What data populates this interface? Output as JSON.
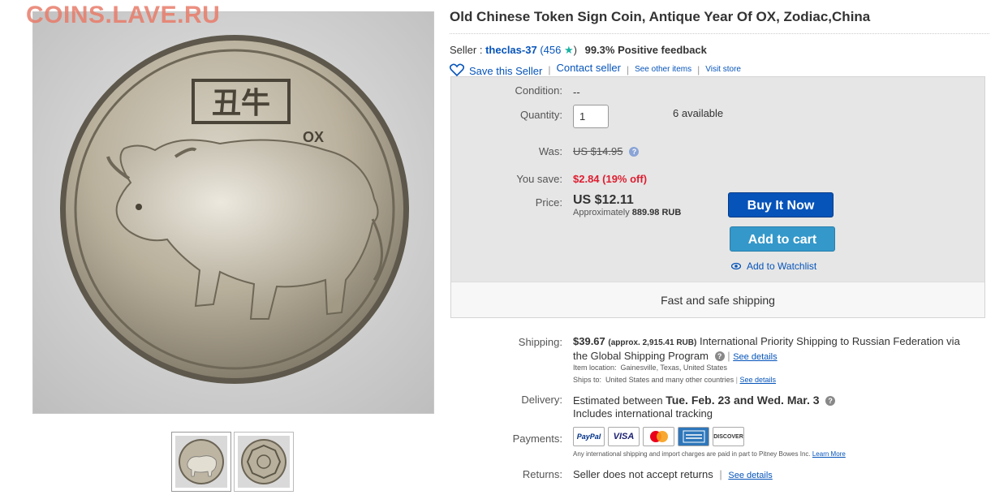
{
  "watermark": "COINS.LAVE.RU",
  "listing": {
    "title": "Old Chinese Token Sign Coin, Antique Year Of OX, Zodiac,China"
  },
  "photo": {
    "coin_chars": "丑牛",
    "coin_text": "OX"
  },
  "seller": {
    "prefix": "Seller :",
    "name": "theclas-37",
    "score_open": "(456",
    "score_close": ")",
    "feedback": "99.3% Positive feedback",
    "save_label": "Save this Seller",
    "contact_label": "Contact seller",
    "see_other_label": "See other items",
    "visit_store_label": "Visit store",
    "sep": "|"
  },
  "buybox": {
    "condition_label": "Condition:",
    "condition_value": "--",
    "quantity_label": "Quantity:",
    "quantity_value": "1",
    "available": "6 available",
    "was_label": "Was:",
    "was_value": "US $14.95",
    "save_label": "You save:",
    "save_value": "$2.84 (19% off)",
    "price_label": "Price:",
    "price_value": "US $12.11",
    "approx_prefix": "Approximately",
    "approx_value": "889.98 RUB",
    "buy_now": "Buy It Now",
    "add_to_cart": "Add to cart",
    "watchlist": "Add to Watchlist",
    "shipping_band": "Fast and safe shipping"
  },
  "details": {
    "shipping_label": "Shipping:",
    "shipping_price": "$39.67",
    "shipping_approx": "(approx. 2,915.41 RUB)",
    "shipping_desc": "International Priority Shipping to Russian Federation  via",
    "shipping_desc2": "the Global Shipping Program",
    "see_details": "See details",
    "item_location_label": "Item location:",
    "item_location": "Gainesville, Texas, United States",
    "ships_to_label": "Ships to:",
    "ships_to": "United States and many other countries",
    "delivery_label": "Delivery:",
    "delivery_prefix": "Estimated between",
    "delivery_dates": "Tue. Feb. 23 and Wed. Mar. 3",
    "delivery_tracking": "Includes international tracking",
    "payments_label": "Payments:",
    "payment_methods": [
      "PayPal",
      "VISA",
      "MasterCard",
      "AMERICAN EXPRESS",
      "DISCOVER"
    ],
    "payments_note": "Any international shipping and import charges are paid in part to Pitney Bowes Inc.",
    "learn_more": "Learn More",
    "returns_label": "Returns:",
    "returns_value": "Seller does not accept returns"
  },
  "colors": {
    "link": "#0654ba",
    "buy_now": "#0654ba",
    "add_to_cart": "#3498ca",
    "savings": "#dd1e31",
    "watermark": "#e87c6a"
  }
}
